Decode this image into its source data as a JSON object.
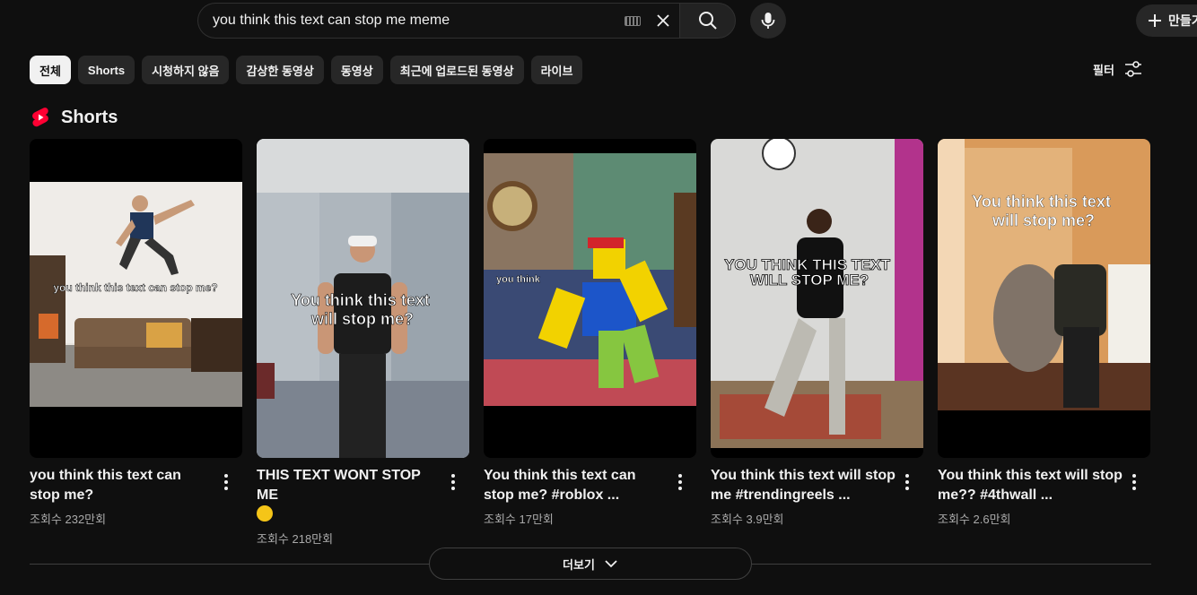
{
  "search": {
    "query": "you think this text can stop me meme"
  },
  "header": {
    "create_label": "만들기"
  },
  "chips": [
    "전체",
    "Shorts",
    "시청하지 않음",
    "감상한 동영상",
    "동영상",
    "최근에 업로드된 동영상",
    "라이브"
  ],
  "filter_label": "필터",
  "shorts_section": {
    "title": "Shorts",
    "brand_color": "#ff0033",
    "items": [
      {
        "title": "you think this text can stop me?",
        "views": "조회수 232만회",
        "overlay": "you think this text can stop me?"
      },
      {
        "title": "THIS TEXT WONT STOP ME",
        "views": "조회수 218만회",
        "overlay": "You think this text will stop me?"
      },
      {
        "title": "You think this text can stop me? #roblox ...",
        "views": "조회수 17만회",
        "overlay": "you think"
      },
      {
        "title": "You think this text will stop me #trendingreels ...",
        "views": "조회수 3.9만회",
        "overlay": "YOU THINK THIS TEXT WILL STOP ME?"
      },
      {
        "title": "You think this text will stop me?? #4thwall ...",
        "views": "조회수 2.6만회",
        "overlay": "You think this text will stop me?"
      }
    ]
  },
  "show_more_label": "더보기"
}
